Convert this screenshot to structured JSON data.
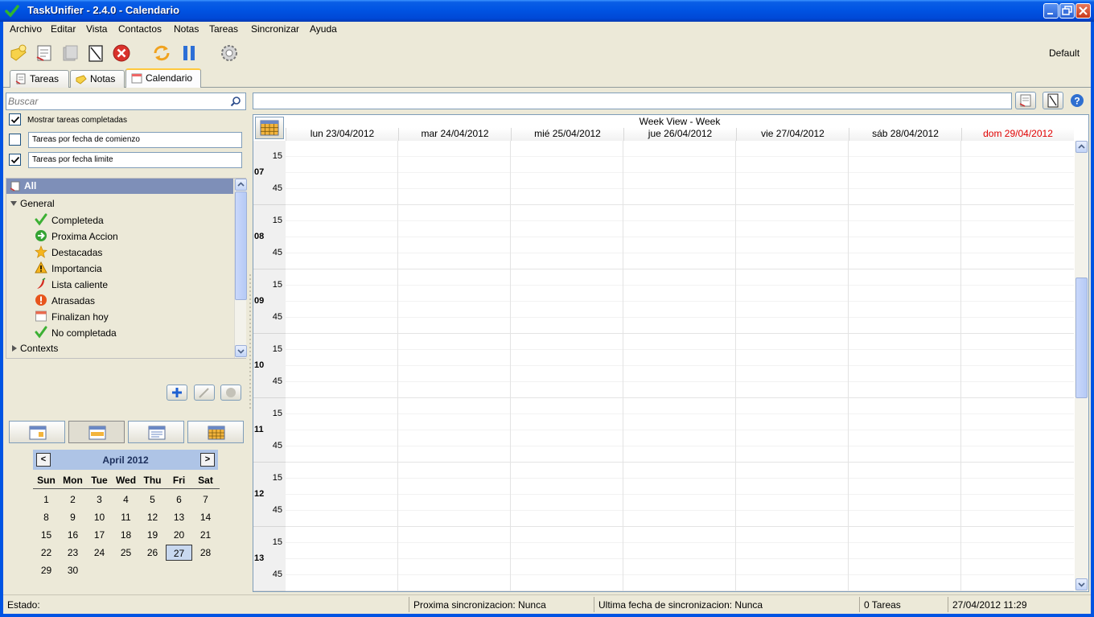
{
  "window": {
    "title": "TaskUnifier - 2.4.0 - Calendario"
  },
  "menu": [
    "Archivo",
    "Editar",
    "Vista",
    "Contactos",
    "Notas",
    "Tareas",
    "Sincronizar",
    "Ayuda"
  ],
  "toolbar": {
    "icons": [
      "add-note-icon",
      "add-task-icon",
      "duplicate-icon",
      "edit-icon",
      "delete-icon",
      "synchronize-icon",
      "pause-icon",
      "settings-icon"
    ],
    "profile": "Default"
  },
  "tabs": [
    {
      "label": "Tareas",
      "icon": "tasks-icon"
    },
    {
      "label": "Notas",
      "icon": "notes-icon"
    },
    {
      "label": "Calendario",
      "icon": "calendar-icon",
      "active": true
    }
  ],
  "search": {
    "placeholder": "Buscar",
    "value": ""
  },
  "options": {
    "show_completed": {
      "label": "Mostrar tareas completadas",
      "checked": true
    },
    "by_start": {
      "label": "Tareas por fecha de comienzo",
      "checked": false
    },
    "by_due": {
      "label": "Tareas por fecha limite",
      "checked": true
    }
  },
  "tree": {
    "all": "All",
    "general_label": "General",
    "items": [
      {
        "label": "Completeda",
        "icon": "check-icon"
      },
      {
        "label": "Proxima Accion",
        "icon": "next-action-icon"
      },
      {
        "label": "Destacadas",
        "icon": "star-icon"
      },
      {
        "label": "Importancia",
        "icon": "warning-icon"
      },
      {
        "label": "Lista caliente",
        "icon": "hot-pepper-icon"
      },
      {
        "label": "Atrasadas",
        "icon": "overdue-icon"
      },
      {
        "label": "Finalizan hoy",
        "icon": "calendar-today-icon"
      },
      {
        "label": "No completada",
        "icon": "check-icon"
      }
    ],
    "contexts_label": "Contexts"
  },
  "mini_calendar": {
    "month": "April 2012",
    "prev": "<",
    "next": ">",
    "days_of_week": [
      "Sun",
      "Mon",
      "Tue",
      "Wed",
      "Thu",
      "Fri",
      "Sat"
    ],
    "weeks": [
      [
        "1",
        "2",
        "3",
        "4",
        "5",
        "6",
        "7"
      ],
      [
        "8",
        "9",
        "10",
        "11",
        "12",
        "13",
        "14"
      ],
      [
        "15",
        "16",
        "17",
        "18",
        "19",
        "20",
        "21"
      ],
      [
        "22",
        "23",
        "24",
        "25",
        "26",
        "27",
        "28"
      ],
      [
        "29",
        "30",
        "",
        "",
        "",
        "",
        ""
      ]
    ],
    "selected": "27"
  },
  "calendar": {
    "title": "Week View - Week",
    "days": [
      "lun 23/04/2012",
      "mar 24/04/2012",
      "mié 25/04/2012",
      "jue 26/04/2012",
      "vie 27/04/2012",
      "sáb 28/04/2012",
      "dom 29/04/2012"
    ],
    "hours": [
      "07",
      "08",
      "09",
      "10",
      "11",
      "12",
      "13"
    ],
    "minute_marks": [
      "15",
      "45"
    ],
    "sunday_color": "#e00000"
  },
  "status": {
    "state": "Estado:",
    "next_sync": "Proxima sincronizacion: Nunca",
    "last_sync": "Ultima fecha de sincronizacion: Nunca",
    "task_count": "0 Tareas",
    "datetime": "27/04/2012 11:29"
  }
}
